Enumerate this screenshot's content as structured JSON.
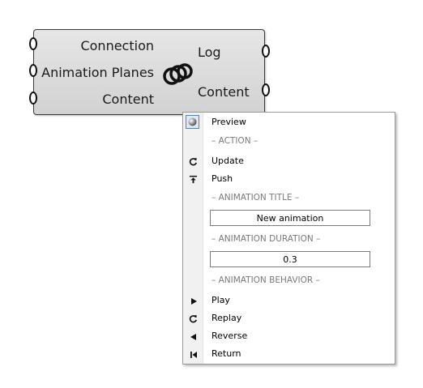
{
  "component": {
    "inputs": [
      "Connection",
      "Animation Planes",
      "Content"
    ],
    "outputs": [
      "Log",
      "Content"
    ],
    "icon": "linked-rings-icon"
  },
  "menu": {
    "preview_label": "Preview",
    "action_header": "– ACTION –",
    "update_label": "Update",
    "push_label": "Push",
    "title_header": "– ANIMATION TITLE –",
    "title_value": "New animation",
    "duration_header": "– ANIMATION DURATION –",
    "duration_value": "0.3",
    "behavior_header": "– ANIMATION BEHAVIOR –",
    "play_label": "Play",
    "replay_label": "Replay",
    "reverse_label": "Reverse",
    "return_label": "Return"
  }
}
